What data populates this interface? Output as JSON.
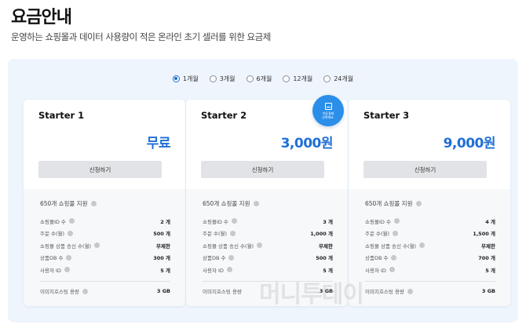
{
  "header": {
    "title": "요금안내",
    "subtitle": "운영하는 쇼핑몰과 데이터 사용량이 적은 온라인 초기 셀러를 위한 요금제"
  },
  "periods": [
    {
      "label": "1개월",
      "selected": true
    },
    {
      "label": "3개월",
      "selected": false
    },
    {
      "label": "6개월",
      "selected": false
    },
    {
      "label": "12개월",
      "selected": false
    },
    {
      "label": "24개월",
      "selected": false
    }
  ],
  "badge": {
    "icon": "document-icon",
    "line1": "자동결제",
    "line2": "선택해요."
  },
  "apply_label": "신청하기",
  "colors": {
    "accent": "#1f6fd6",
    "panel_bg": "#eef5fc",
    "badge": "#2b8ee8"
  },
  "plans": [
    {
      "name": "Starter 1",
      "price": "무료",
      "support": "650개 쇼핑몰 지원",
      "rows": [
        {
          "label": "쇼핑몰ID 수",
          "value": "2 개"
        },
        {
          "label": "주문 수(월)",
          "value": "500 개"
        },
        {
          "label": "쇼핑몰 상품 송신 수(월)",
          "value": "무제한"
        },
        {
          "label": "상품DB 수",
          "value": "300 개"
        },
        {
          "label": "사용자 ID",
          "value": "5 개"
        }
      ],
      "hosting": {
        "label": "이미지호스팅 용량",
        "value": "3 GB"
      }
    },
    {
      "name": "Starter 2",
      "price": "3,000원",
      "support": "650개 쇼핑몰 지원",
      "rows": [
        {
          "label": "쇼핑몰ID 수",
          "value": "3 개"
        },
        {
          "label": "주문 수(월)",
          "value": "1,000 개"
        },
        {
          "label": "쇼핑몰 상품 송신 수(월)",
          "value": "무제한"
        },
        {
          "label": "상품DB 수",
          "value": "500 개"
        },
        {
          "label": "사용자 ID",
          "value": "5 개"
        }
      ],
      "hosting": {
        "label": "이미지호스팅 용량",
        "value": "3 GB"
      }
    },
    {
      "name": "Starter 3",
      "price": "9,000원",
      "support": "650개 쇼핑몰 지원",
      "rows": [
        {
          "label": "쇼핑몰ID 수",
          "value": "4 개"
        },
        {
          "label": "주문 수(월)",
          "value": "1,500 개"
        },
        {
          "label": "쇼핑몰 상품 송신 수(월)",
          "value": "무제한"
        },
        {
          "label": "상품DB 수",
          "value": "700 개"
        },
        {
          "label": "사용자 ID",
          "value": "5 개"
        }
      ],
      "hosting": {
        "label": "이미지호스팅 용량",
        "value": "3 GB"
      }
    }
  ],
  "watermark": "머니투데이"
}
